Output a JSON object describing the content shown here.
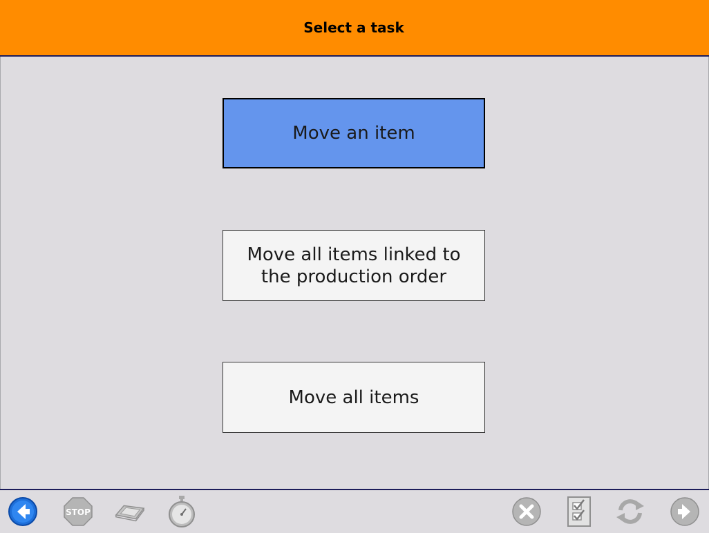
{
  "header": {
    "title": "Select a task"
  },
  "tasks": [
    {
      "label": "Move an item",
      "selected": true
    },
    {
      "label": "Move all items linked to the production order",
      "selected": false
    },
    {
      "label": "Move all items",
      "selected": false
    }
  ],
  "toolbar": {
    "left_icons": [
      "back-arrow-icon",
      "stop-sign-icon",
      "scanner-icon",
      "stopwatch-icon"
    ],
    "right_icons": [
      "cancel-icon",
      "checklist-icon",
      "refresh-icon",
      "forward-arrow-icon"
    ],
    "stop_text": "STOP"
  },
  "colors": {
    "header_bg": "#ff8c00",
    "selected_bg": "#6495ed",
    "page_bg": "#dedce0",
    "button_bg": "#f4f4f4",
    "back_icon": "#1e6fd9",
    "disabled_icon": "#a8a8a8"
  }
}
